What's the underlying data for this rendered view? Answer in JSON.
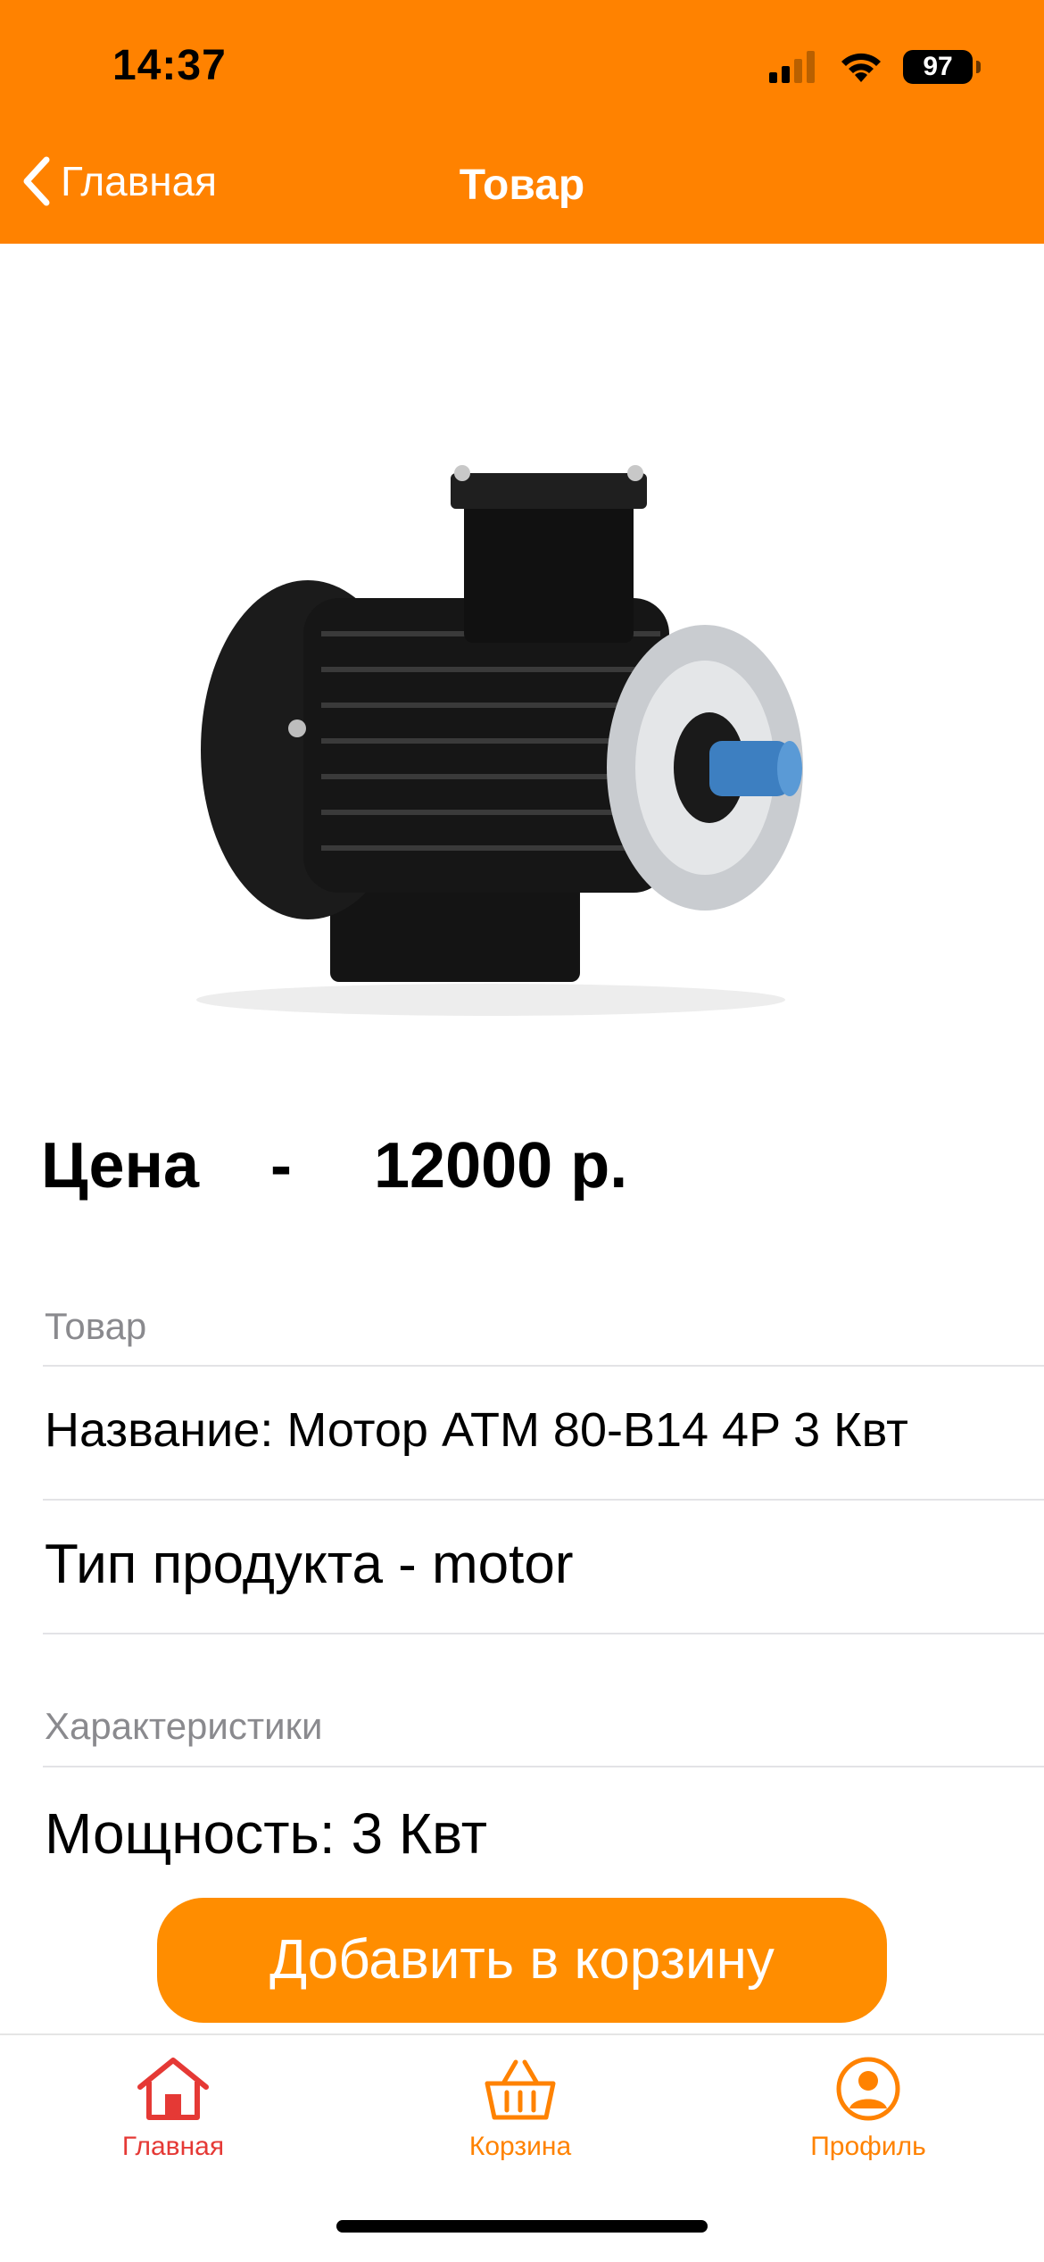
{
  "status_bar": {
    "time": "14:37",
    "battery_level": "97"
  },
  "nav": {
    "back_label": "Главная",
    "title": "Товар"
  },
  "product": {
    "image_icon": "electric-motor",
    "price_label": "Цена",
    "price_dash": "-",
    "price_value": "12000 р."
  },
  "sections": [
    {
      "title": "Товар",
      "rows": [
        "Название: Мотор ATM 80-B14 4P 3 Квт",
        "Тип продукта - motor"
      ]
    },
    {
      "title": "Характеристики",
      "rows": [
        "Мощность: 3 Квт"
      ]
    }
  ],
  "cta": {
    "label": "Добавить в корзину"
  },
  "tabbar": {
    "items": [
      {
        "label": "Главная",
        "icon": "home-icon",
        "color": "#e53935"
      },
      {
        "label": "Корзина",
        "icon": "basket-icon",
        "color": "#ff8200"
      },
      {
        "label": "Профиль",
        "icon": "profile-icon",
        "color": "#ff8200"
      }
    ]
  },
  "colors": {
    "accent": "#ff8200",
    "button": "#ff8d00",
    "active_tab": "#e53935"
  }
}
